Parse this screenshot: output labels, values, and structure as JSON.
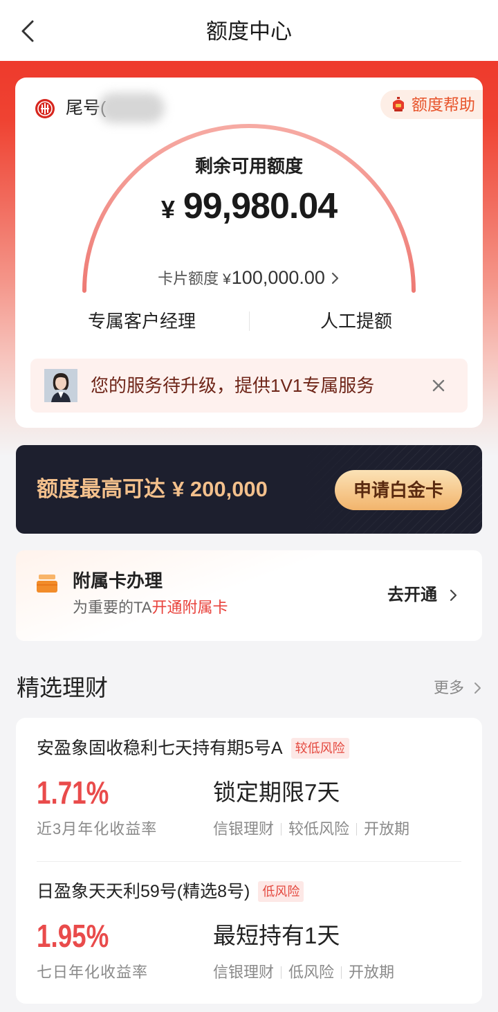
{
  "nav": {
    "title": "额度中心",
    "back_icon": "chevron-left-icon"
  },
  "limit_card": {
    "bank_logo_icon": "citic-bank-logo",
    "tail_label": "尾号(",
    "help_label": "额度帮助",
    "help_icon": "lantern-icon",
    "remaining_label": "剩余可用额度",
    "remaining_currency": "¥",
    "remaining_amount": "99,980.04",
    "limit_label": "卡片额度",
    "limit_currency": "¥",
    "limit_amount": "100,000.00",
    "actions": [
      "专属客户经理",
      "人工提额"
    ],
    "notice": "您的服务待升级，提供1V1专属服务"
  },
  "promo": {
    "text": "额度最高可达",
    "amount": "¥ 200,000",
    "button_label": "申请白金卡"
  },
  "supplementary_card": {
    "title": "附属卡办理",
    "desc_prefix": "为重要的TA",
    "desc_highlight": "开通附属卡",
    "action_label": "去开通"
  },
  "wealth": {
    "title": "精选理财",
    "more_label": "更多",
    "products": [
      {
        "name": "安盈象固收稳利七天持有期5号A",
        "risk": "较低风险",
        "rate": "1.71%",
        "rate_label": "近3月年化收益率",
        "term": "锁定期限7天",
        "tags": [
          "信银理财",
          "较低风险",
          "开放期"
        ]
      },
      {
        "name": "日盈象天天利59号(精选8号)",
        "risk": "低风险",
        "rate": "1.95%",
        "rate_label": "七日年化收益率",
        "term": "最短持有1天",
        "tags": [
          "信银理财",
          "低风险",
          "开放期"
        ]
      }
    ]
  },
  "colors": {
    "accent_red": "#e94b4b",
    "hero_red": "#ee3a2c",
    "promo_bg": "#1d1f2e",
    "gold": "#f3c08c",
    "notice_text": "#6e2518",
    "badge_bg": "#fde8e6"
  }
}
